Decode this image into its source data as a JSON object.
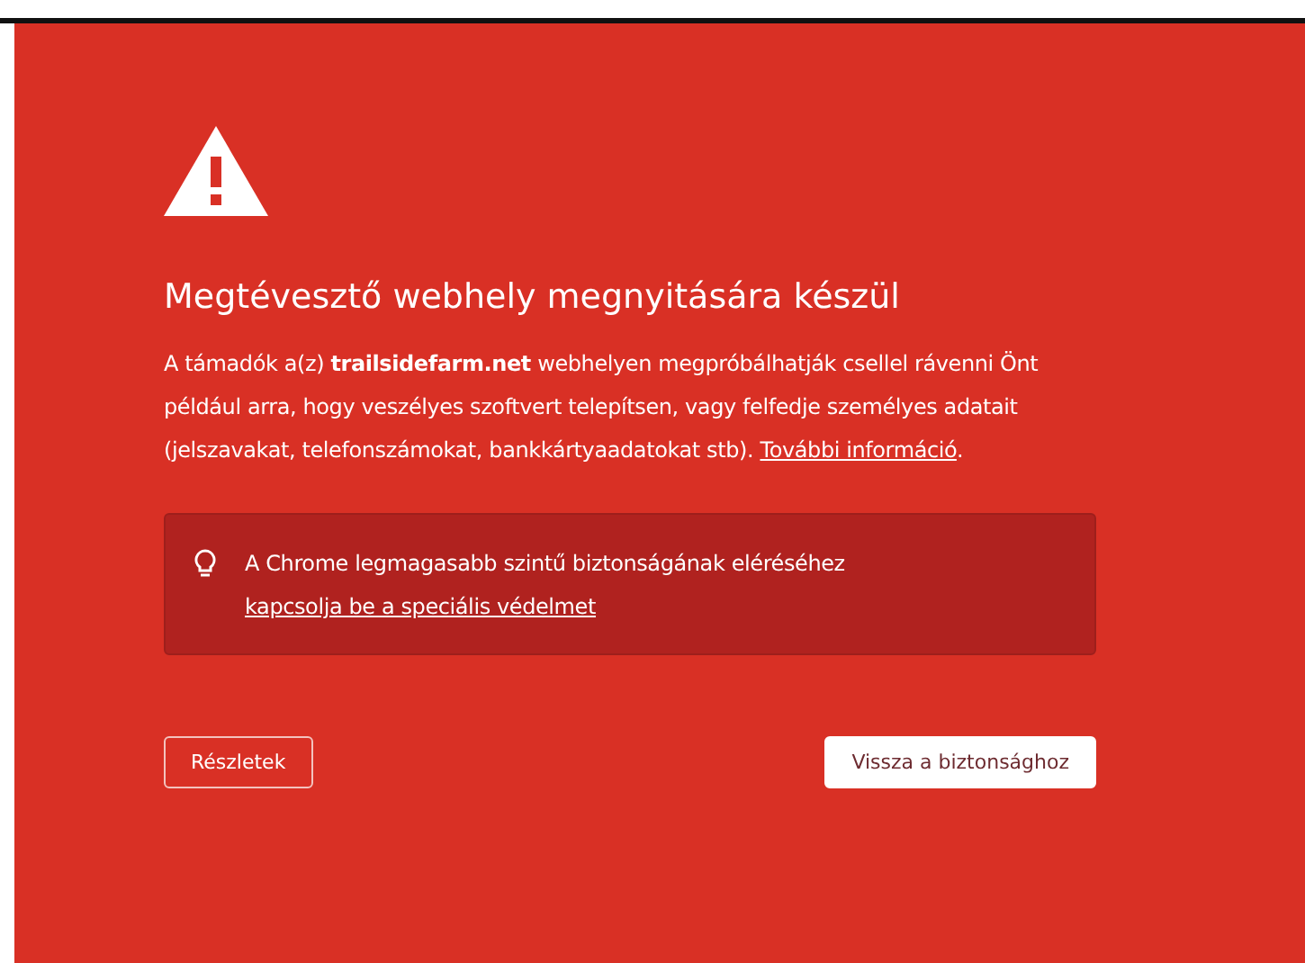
{
  "interstitial": {
    "title": "Megtévesztő webhely megnyitására készül",
    "message": {
      "text": "A támadók a(z) **trailsidefarm.net** webhelyen megpróbálhatják csellel rávenni Önt például arra, hogy veszélyes szoftvert telepítsen, vagy felfedje személyes adatait (jelszavakat, telefonszámokat, bankkártyaadatokat stb). ",
      "link": "További információ",
      "after": "."
    },
    "notice": {
      "text": "A Chrome legmagasabb szintű biztonságának eléréséhez ",
      "link": "kapcsolja be a speciális védelmet"
    },
    "buttons": [
      {
        "label": "Részletek",
        "kind": "secondary"
      },
      {
        "label": "Vissza a biztonsághoz",
        "kind": "primary"
      }
    ]
  }
}
